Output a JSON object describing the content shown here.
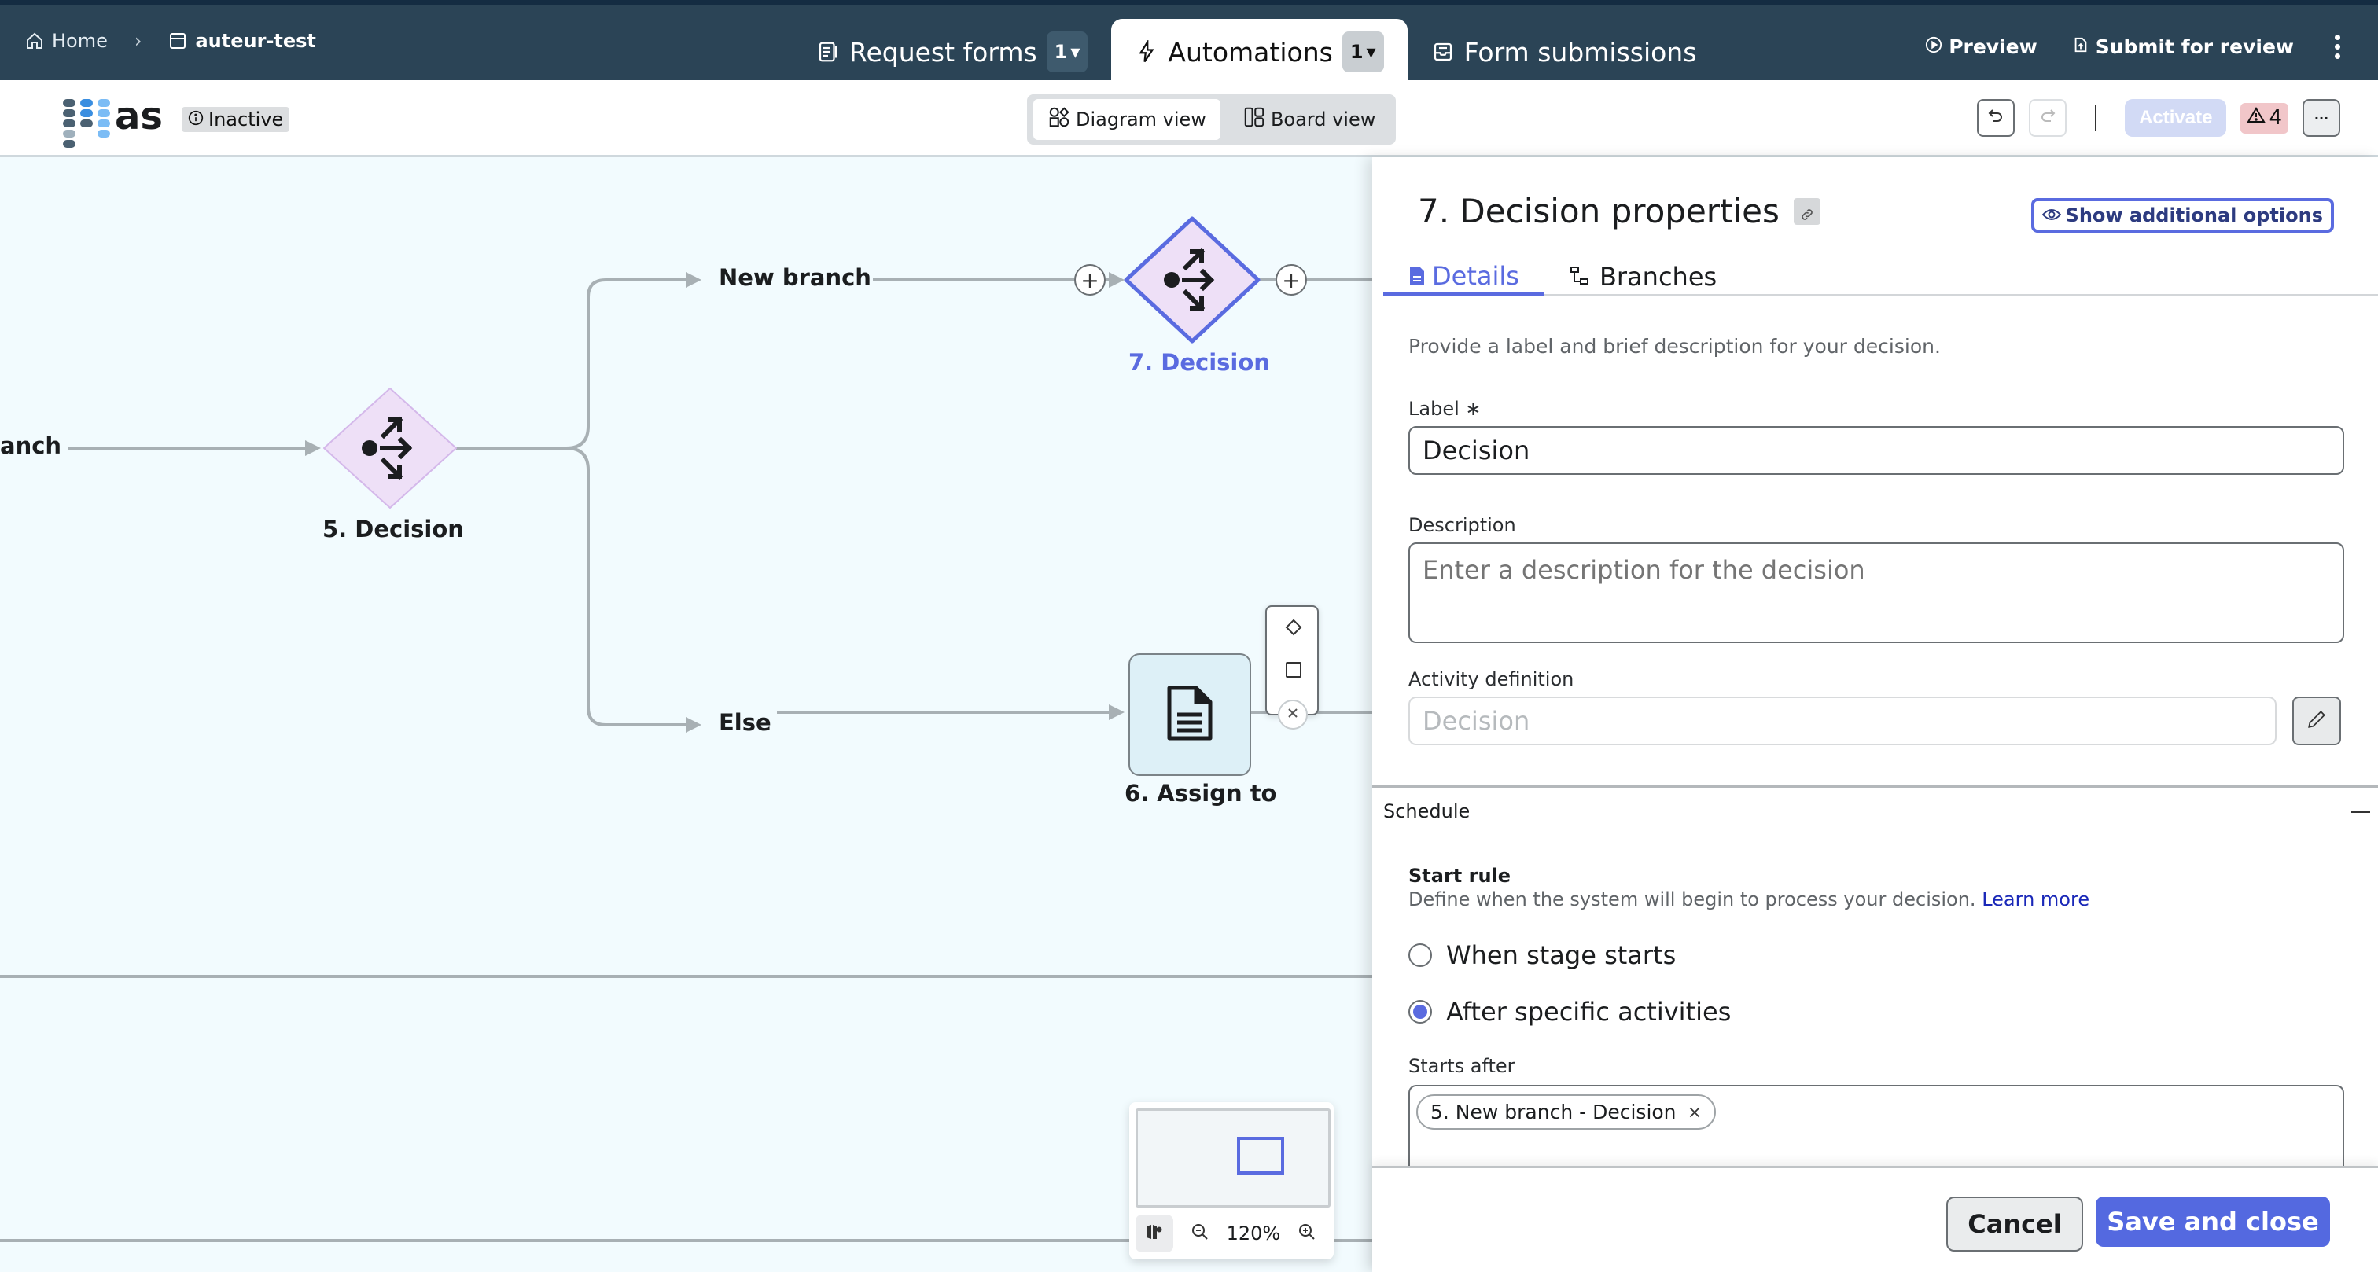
{
  "breadcrumb": {
    "home_label": "Home",
    "project_label": "auteur-test"
  },
  "top_tabs": [
    {
      "label": "Request forms",
      "count": "1",
      "icon": "form-icon",
      "active": false
    },
    {
      "label": "Automations",
      "count": "1",
      "icon": "bolt-icon",
      "active": true
    },
    {
      "label": "Form submissions",
      "icon": "inbox-icon",
      "active": false
    }
  ],
  "top_actions": {
    "preview_label": "Preview",
    "submit_label": "Submit for review"
  },
  "toolbar": {
    "app_name": "as",
    "status": "Inactive",
    "diagram_view_label": "Diagram view",
    "board_view_label": "Board view",
    "active_view": "Diagram view",
    "activate_label": "Activate",
    "warning_count": "4",
    "more_label": "···"
  },
  "canvas": {
    "left_branch_label": "anch",
    "nodes": [
      {
        "id": "5",
        "label": "5. Decision",
        "type": "decision",
        "selected": false
      },
      {
        "id": "7",
        "label": "7. Decision",
        "type": "decision",
        "selected": true
      },
      {
        "id": "6",
        "label": "6. Assign to",
        "type": "task",
        "selected": false
      }
    ],
    "branches": [
      {
        "label": "New branch"
      },
      {
        "label": "Else"
      }
    ],
    "zoom_level": "120%"
  },
  "panel": {
    "title": "7. Decision properties",
    "show_options_label": "Show additional options",
    "tabs": [
      {
        "label": "Details",
        "active": true
      },
      {
        "label": "Branches",
        "active": false
      }
    ],
    "helper": "Provide a label and brief description for your decision.",
    "label_field": {
      "label": "Label",
      "required_mark": "∗",
      "value": "Decision"
    },
    "description_field": {
      "label": "Description",
      "value": "",
      "placeholder": "Enter a description for the decision"
    },
    "activity_field": {
      "label": "Activity definition",
      "value": "",
      "placeholder": "Decision"
    },
    "schedule": {
      "heading": "Schedule",
      "start_rule_heading": "Start rule",
      "start_rule_help": "Define when the system will begin to process your decision.",
      "learn_more": "Learn more",
      "options": [
        {
          "label": "When stage starts",
          "checked": false
        },
        {
          "label": "After specific activities",
          "checked": true
        }
      ],
      "starts_after_label": "Starts after",
      "starts_after_chips": [
        "5. New branch - Decision"
      ]
    },
    "cancel_label": "Cancel",
    "save_label": "Save and close"
  },
  "colors": {
    "topbar_bg": "#2b4456",
    "accent": "#5a6be0",
    "canvas_bg": "#f2fbfe",
    "decision_fill": "#eee0f7",
    "task_fill": "#ddf0f7",
    "warning_bg": "#f1c6c9"
  }
}
